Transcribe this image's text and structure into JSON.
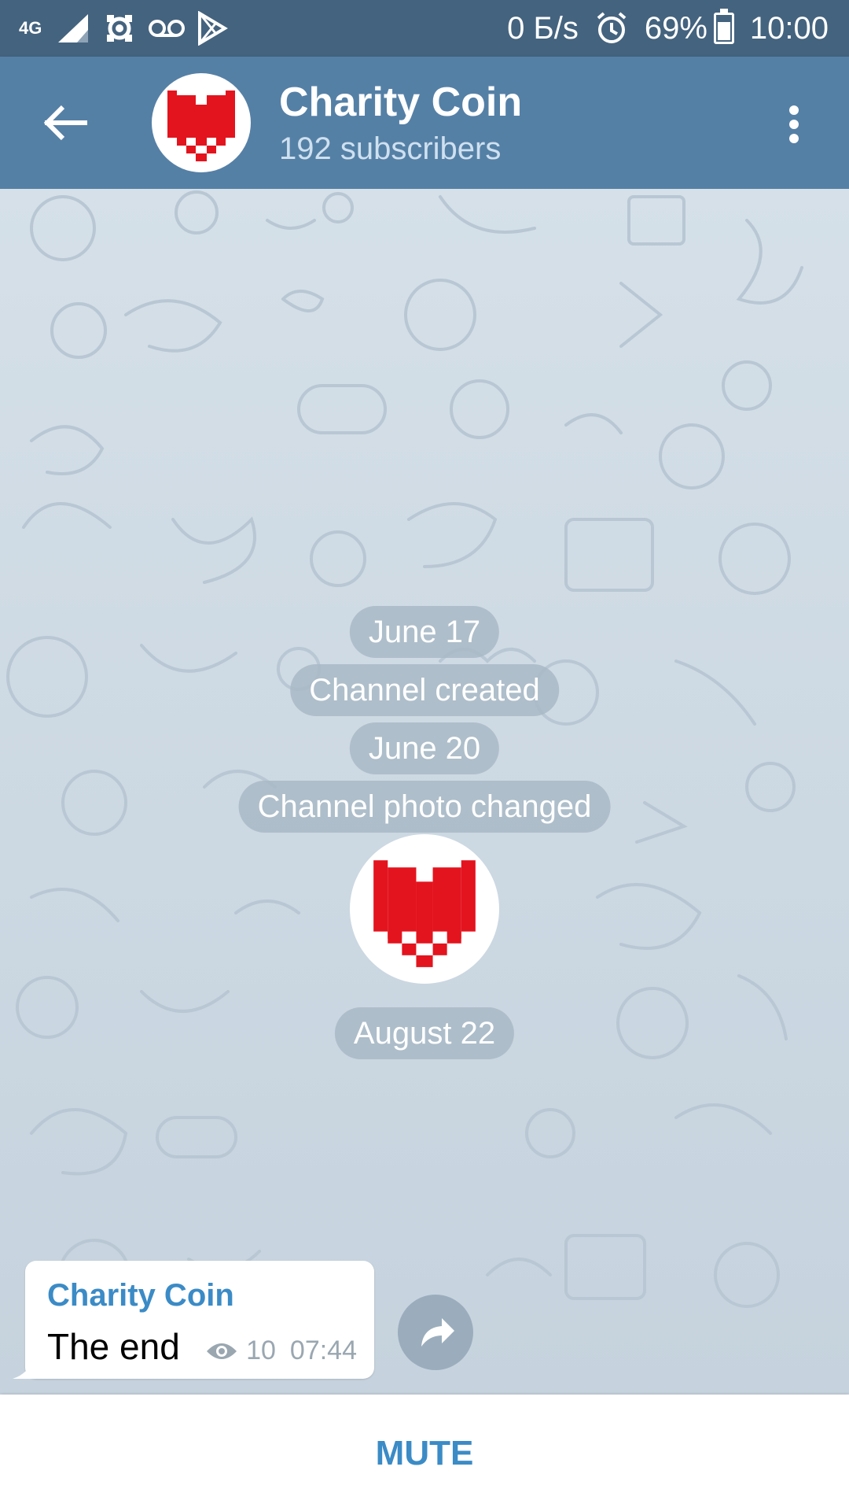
{
  "status_bar": {
    "network": "4G",
    "net_speed": "0 Б/s",
    "battery": "69%",
    "time": "10:00",
    "icons": [
      "signal-icon",
      "app-notification-icon",
      "voicemail-icon",
      "play-store-icon",
      "alarm-icon",
      "battery-icon"
    ]
  },
  "header": {
    "title": "Charity Coin",
    "subtitle": "192 subscribers",
    "icons": [
      "back-arrow-icon",
      "channel-avatar-heart-icon",
      "more-vertical-icon"
    ]
  },
  "chat": {
    "service_messages": [
      {
        "label": "June 17"
      },
      {
        "label": "Channel created"
      },
      {
        "label": "June 20"
      },
      {
        "label": "Channel photo changed"
      },
      {
        "label": "August 22"
      }
    ],
    "message": {
      "sender": "Charity Coin",
      "text": "The end",
      "views": "10",
      "time": "07:44",
      "icons": [
        "views-eye-icon",
        "share-icon"
      ]
    }
  },
  "footer": {
    "mute_label": "MUTE"
  },
  "colors": {
    "status_bar": "#44637f",
    "app_bar": "#5580a6",
    "accent": "#3b8bc6",
    "heart": "#e3141e"
  }
}
